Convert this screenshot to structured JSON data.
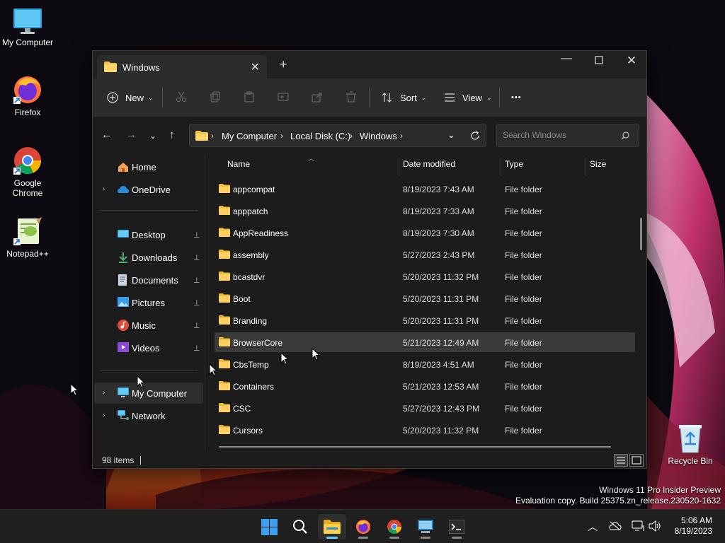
{
  "desktop": {
    "icons": [
      {
        "label": "My Computer",
        "icon": "monitor-icon"
      },
      {
        "label": "Firefox",
        "icon": "firefox-icon"
      },
      {
        "label": "Google Chrome",
        "icon": "chrome-icon"
      },
      {
        "label": "Notepad++",
        "icon": "notepadpp-icon"
      },
      {
        "label": "Recycle Bin",
        "icon": "recycle-bin-icon"
      }
    ],
    "watermark": {
      "line1": "Windows 11 Pro Insider Preview",
      "line2": "Evaluation copy. Build 25375.zn_release.230520-1632"
    }
  },
  "window": {
    "tab_title": "Windows",
    "tab_close": "✕",
    "new_tab": "+",
    "controls": {
      "minimize": "—",
      "maximize": "☐",
      "close": "✕"
    },
    "toolbar": {
      "new_label": "New",
      "sort_label": "Sort",
      "view_label": "View",
      "more_label": "•••",
      "chevron": "⌄"
    },
    "address": {
      "breadcrumbs": [
        "My Computer",
        "Local Disk (C:)",
        "Windows"
      ],
      "separator": "›",
      "search_placeholder": "Search Windows"
    },
    "nav_pane": {
      "top": [
        {
          "label": "Home",
          "icon": "home-icon"
        },
        {
          "label": "OneDrive",
          "icon": "onedrive-icon"
        }
      ],
      "quick_access": [
        {
          "label": "Desktop",
          "icon": "desktop-folder-icon"
        },
        {
          "label": "Downloads",
          "icon": "downloads-icon"
        },
        {
          "label": "Documents",
          "icon": "documents-icon"
        },
        {
          "label": "Pictures",
          "icon": "pictures-icon"
        },
        {
          "label": "Music",
          "icon": "music-icon"
        },
        {
          "label": "Videos",
          "icon": "videos-icon"
        }
      ],
      "bottom": [
        {
          "label": "My Computer",
          "icon": "monitor-icon"
        },
        {
          "label": "Network",
          "icon": "network-icon"
        }
      ],
      "selected": "My Computer",
      "expand_glyph": "›",
      "pin_glyph": "📌"
    },
    "columns": {
      "name": "Name",
      "date": "Date modified",
      "type": "Type",
      "size": "Size"
    },
    "files": [
      {
        "name": "appcompat",
        "date": "8/19/2023 7:43 AM",
        "type": "File folder"
      },
      {
        "name": "apppatch",
        "date": "8/19/2023 7:33 AM",
        "type": "File folder"
      },
      {
        "name": "AppReadiness",
        "date": "8/19/2023 7:30 AM",
        "type": "File folder"
      },
      {
        "name": "assembly",
        "date": "5/27/2023 2:43 PM",
        "type": "File folder"
      },
      {
        "name": "bcastdvr",
        "date": "5/20/2023 11:32 PM",
        "type": "File folder"
      },
      {
        "name": "Boot",
        "date": "5/20/2023 11:31 PM",
        "type": "File folder"
      },
      {
        "name": "Branding",
        "date": "5/20/2023 11:31 PM",
        "type": "File folder"
      },
      {
        "name": "BrowserCore",
        "date": "5/21/2023 12:49 AM",
        "type": "File folder"
      },
      {
        "name": "CbsTemp",
        "date": "8/19/2023 4:51 AM",
        "type": "File folder"
      },
      {
        "name": "Containers",
        "date": "5/21/2023 12:53 AM",
        "type": "File folder"
      },
      {
        "name": "CSC",
        "date": "5/27/2023 12:43 PM",
        "type": "File folder"
      },
      {
        "name": "Cursors",
        "date": "5/20/2023 11:32 PM",
        "type": "File folder"
      }
    ],
    "selected_file": "BrowserCore",
    "status": {
      "item_count": "98 items"
    }
  },
  "taskbar": {
    "apps": [
      {
        "name": "start",
        "icon": "windows-logo-icon"
      },
      {
        "name": "search",
        "icon": "search-icon"
      },
      {
        "name": "file-explorer",
        "icon": "folder-icon",
        "active": true
      },
      {
        "name": "firefox",
        "icon": "firefox-icon"
      },
      {
        "name": "chrome",
        "icon": "chrome-icon"
      },
      {
        "name": "remote-desktop",
        "icon": "rdp-icon"
      },
      {
        "name": "terminal",
        "icon": "terminal-icon"
      }
    ],
    "clock": {
      "time": "5:06 AM",
      "date": "8/19/2023"
    }
  },
  "colors": {
    "accent": "#60cdff",
    "folder": "#f4c542",
    "window_bg": "#1c1c1c",
    "toolbar_bg": "#2c2c2c",
    "selected_row": "#3a3a3a"
  }
}
